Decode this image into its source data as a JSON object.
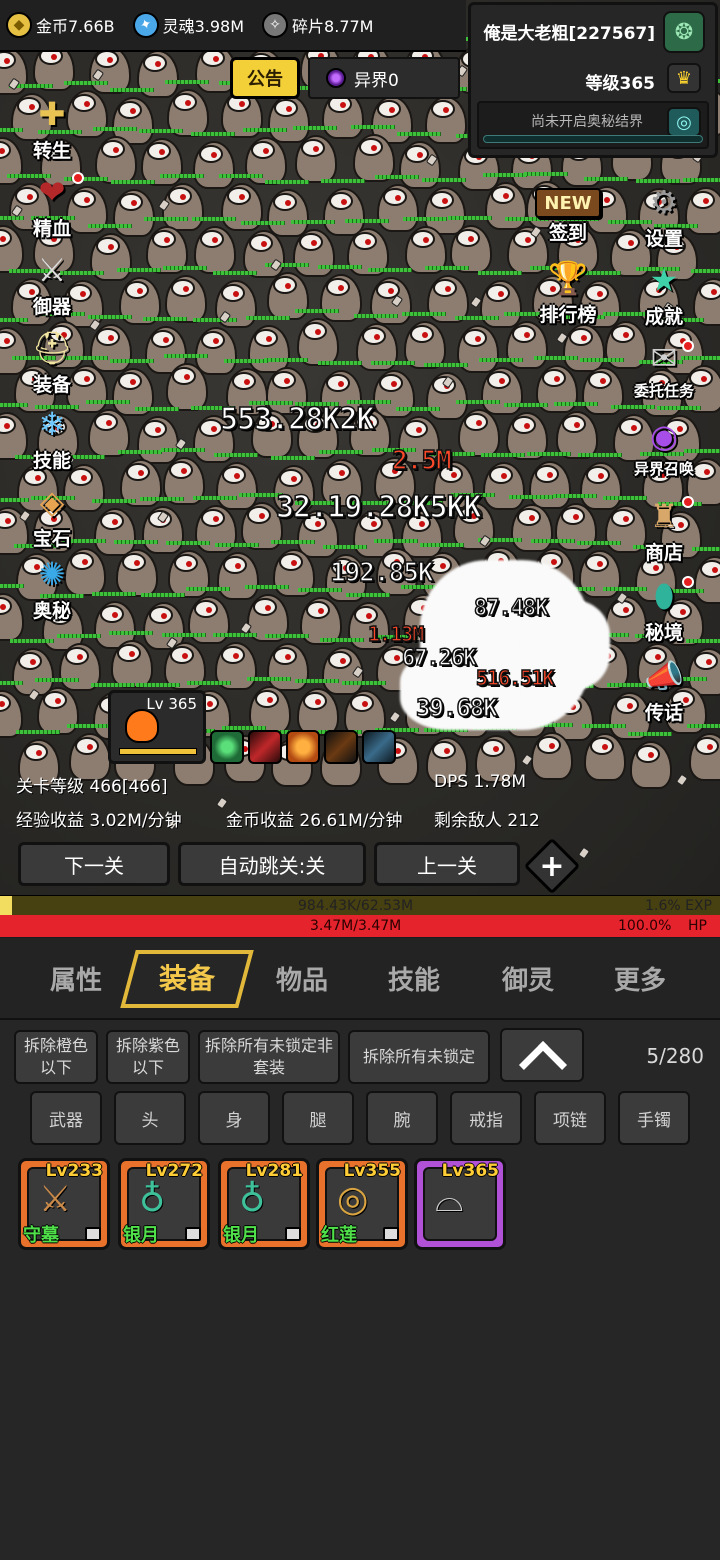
{
  "resources": {
    "coins": "金币7.66B",
    "souls": "灵魂3.98M",
    "shards": "碎片8.77M"
  },
  "notice_label": "公告",
  "otherworld_label": "异界0",
  "player": {
    "name": "俺是大老粗[227567]",
    "level": "等级365",
    "mystic_label": "尚未开启奥秘结界"
  },
  "left_menu": [
    {
      "label": "转生",
      "icon": "cross-staff-icon"
    },
    {
      "label": "精血",
      "icon": "blood-meat-icon"
    },
    {
      "label": "御器",
      "icon": "sword-icon"
    },
    {
      "label": "装备",
      "icon": "helmet-icon"
    },
    {
      "label": "技能",
      "icon": "ice-crystal-icon"
    },
    {
      "label": "宝石",
      "icon": "gem-pouch-icon"
    },
    {
      "label": "奥秘",
      "icon": "blue-vortex-icon"
    }
  ],
  "right_menu": [
    {
      "label": "签到",
      "icon": "new-sign-icon",
      "new_tag": "NEW"
    },
    {
      "label": "设置",
      "icon": "gear-icon"
    },
    {
      "label": "排行榜",
      "icon": "trophy-icon"
    },
    {
      "label": "成就",
      "icon": "star-icon"
    },
    {
      "label": "委托任务",
      "icon": "scroll-icon"
    },
    {
      "label": "异界召唤",
      "icon": "purple-portal-icon"
    },
    {
      "label": "商店",
      "icon": "shop-bag-icon"
    },
    {
      "label": "秘境",
      "icon": "green-portal-icon"
    },
    {
      "label": "传话",
      "icon": "megaphone-icon"
    }
  ],
  "damage_numbers": [
    {
      "text": "553.28K2K",
      "crit": false
    },
    {
      "text": "2.5M",
      "crit": true
    },
    {
      "text": "32.19.28K5KK",
      "crit": false
    },
    {
      "text": "192.85K",
      "crit": false
    },
    {
      "text": "87.48K",
      "crit": false
    },
    {
      "text": "1.13M",
      "crit": true
    },
    {
      "text": "67.26K",
      "crit": false
    },
    {
      "text": "516.51K",
      "crit": true
    },
    {
      "text": "39.68K",
      "crit": false
    }
  ],
  "hero_level": "Lv 365",
  "stats": {
    "stage_level": "关卡等级 466[466]",
    "dps": "DPS 1.78M",
    "exp_rate": "经验收益 3.02M/分钟",
    "coin_rate": "金币收益 26.61M/分钟",
    "enemies_left": "剩余敌人 212"
  },
  "nav": {
    "next": "下一关",
    "auto": "自动跳关:关",
    "prev": "上一关",
    "plus": "+"
  },
  "exp_bar": {
    "value": "984.43K/62.53M",
    "percent": "1.6% EXP",
    "fraction": 0.016
  },
  "hp_bar": {
    "value": "3.47M/3.47M",
    "percent": "100.0%",
    "unit": "HP",
    "fraction": 1.0
  },
  "tabs": [
    {
      "label": "属性"
    },
    {
      "label": "装备",
      "active": true
    },
    {
      "label": "物品"
    },
    {
      "label": "技能"
    },
    {
      "label": "御灵"
    },
    {
      "label": "更多"
    }
  ],
  "ops": {
    "remove_orange": "拆除橙色以下",
    "remove_purple": "拆除紫色以下",
    "remove_unlocked_nonset": "拆除所有未锁定非套装",
    "remove_unlocked": "拆除所有未锁定",
    "bag_count": "5/280"
  },
  "categories": [
    "武器",
    "头",
    "身",
    "腿",
    "腕",
    "戒指",
    "项链",
    "手镯"
  ],
  "items": [
    {
      "level": "Lv233",
      "name": "守墓",
      "rarity": "orange",
      "icon": "sword-icon",
      "locked": true
    },
    {
      "level": "Lv272",
      "name": "银月",
      "rarity": "orange",
      "icon": "necklace-icon",
      "locked": true
    },
    {
      "level": "Lv281",
      "name": "银月",
      "rarity": "orange",
      "icon": "necklace-icon",
      "locked": true
    },
    {
      "level": "Lv355",
      "name": "红莲",
      "rarity": "orange",
      "icon": "bracelet-icon",
      "locked": true
    },
    {
      "level": "Lv365",
      "name": "",
      "rarity": "purple",
      "icon": "hat-icon",
      "locked": false
    }
  ],
  "colors": {
    "accent_gold": "#e2b83a",
    "exp_fill": "#f3dd60",
    "hp_fill": "#e5232c",
    "orange_rarity": "#e8722b",
    "purple_rarity": "#b152d6",
    "item_name_green": "#4fe04a"
  }
}
